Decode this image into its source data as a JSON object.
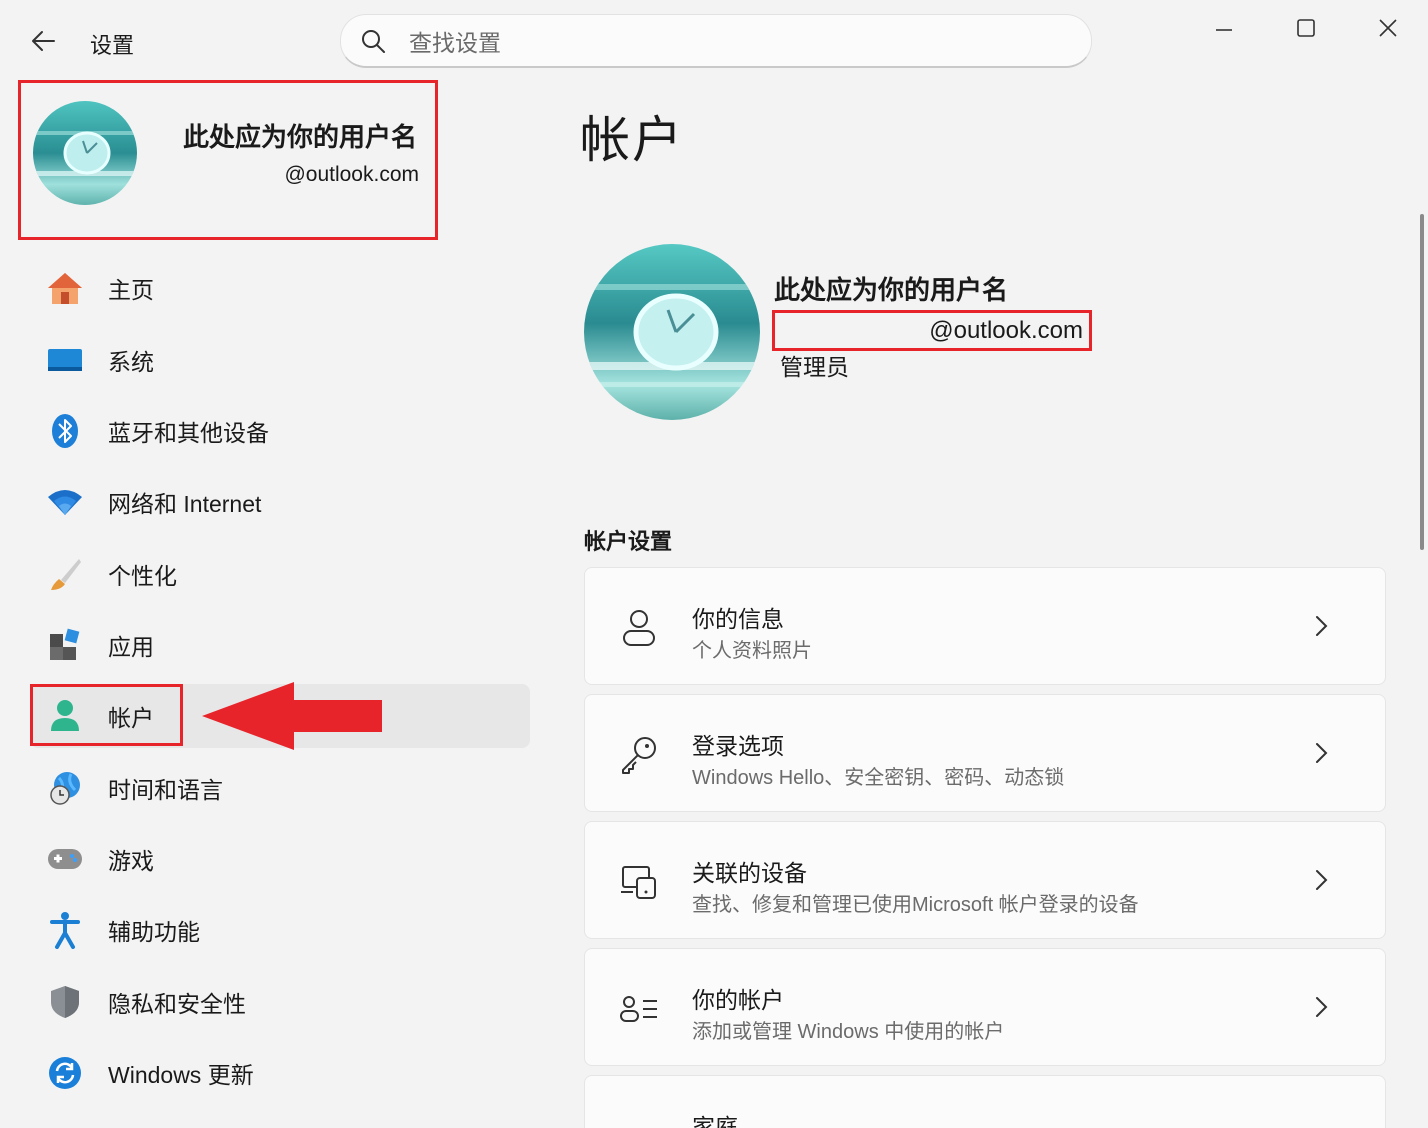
{
  "app": {
    "title": "设置",
    "search_placeholder": "查找设置"
  },
  "profile": {
    "name": "此处应为你的用户名",
    "email": "@outlook.com"
  },
  "sidebar": {
    "items": [
      {
        "label": "主页",
        "icon": "home-icon"
      },
      {
        "label": "系统",
        "icon": "system-icon"
      },
      {
        "label": "蓝牙和其他设备",
        "icon": "bluetooth-icon"
      },
      {
        "label": "网络和 Internet",
        "icon": "wifi-icon"
      },
      {
        "label": "个性化",
        "icon": "brush-icon"
      },
      {
        "label": "应用",
        "icon": "apps-icon"
      },
      {
        "label": "帐户",
        "icon": "account-icon",
        "active": true
      },
      {
        "label": "时间和语言",
        "icon": "globe-clock-icon"
      },
      {
        "label": "游戏",
        "icon": "gamepad-icon"
      },
      {
        "label": "辅助功能",
        "icon": "accessibility-icon"
      },
      {
        "label": "隐私和安全性",
        "icon": "shield-icon"
      },
      {
        "label": "Windows 更新",
        "icon": "update-icon"
      }
    ]
  },
  "main": {
    "page_title": "帐户",
    "user": {
      "name": "此处应为你的用户名",
      "email": "@outlook.com",
      "role": "管理员"
    },
    "section_title": "帐户设置",
    "cards": [
      {
        "title": "你的信息",
        "subtitle": "个人资料照片",
        "icon": "person-icon"
      },
      {
        "title": "登录选项",
        "subtitle": "Windows Hello、安全密钥、密码、动态锁",
        "icon": "key-icon"
      },
      {
        "title": "关联的设备",
        "subtitle": "查找、修复和管理已使用Microsoft 帐户登录的设备",
        "icon": "linked-devices-icon"
      },
      {
        "title": "你的帐户",
        "subtitle": "添加或管理 Windows 中使用的帐户",
        "icon": "people-list-icon"
      },
      {
        "title": "家庭",
        "subtitle": "",
        "icon": "family-icon"
      }
    ]
  },
  "colors": {
    "highlight_red": "#e8242b",
    "accent_blue": "#0067c0"
  }
}
